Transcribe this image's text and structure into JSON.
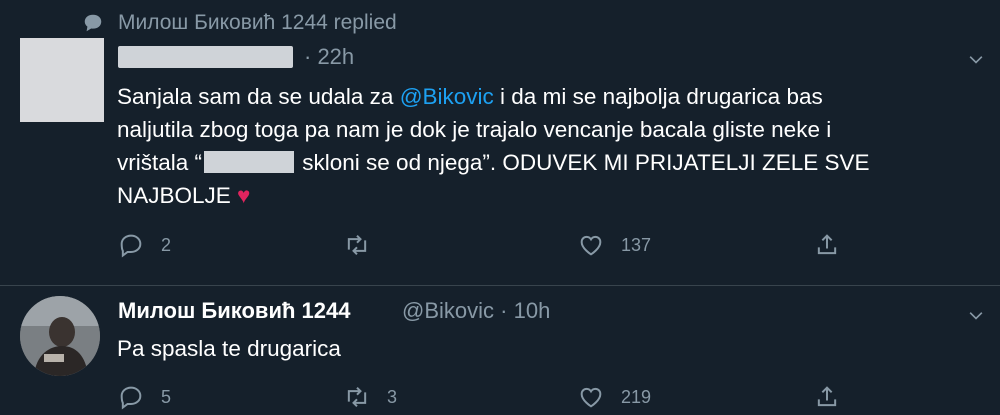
{
  "reply_context": {
    "icon": "speech-bubble-icon",
    "text": "Милош Биковић 1244 replied"
  },
  "tweet1": {
    "author_name_redacted": true,
    "time": "· 22h",
    "text_prefix": "Sanjala sam da se udala za ",
    "mention": "@Bikovic",
    "text_line1_rest": " i da mi se najbolja drugarica bas",
    "text_line2": "naljutila zbog toga pa nam je dok je trajalo vencanje bacala gliste neke i",
    "text_line3_pre": "vrištala “",
    "text_line3_post": " skloni se od njega”. ODUVEK MI PRIJATELJI ZELE SVE",
    "text_line4": "NAJBOLJE ",
    "emoji": "♥",
    "actions": {
      "reply_count": "2",
      "retweet_count": "",
      "like_count": "137"
    }
  },
  "tweet2": {
    "name": "Милош Биковић 1244",
    "handle": "@Bikovic",
    "time": "· 10h",
    "text": "Pa spasla te drugarica",
    "actions": {
      "reply_count": "5",
      "retweet_count": "3",
      "like_count": "219"
    }
  },
  "colors": {
    "background": "#15202b",
    "muted": "#8899a6",
    "link": "#1da1f2",
    "heart": "#e0245e"
  }
}
